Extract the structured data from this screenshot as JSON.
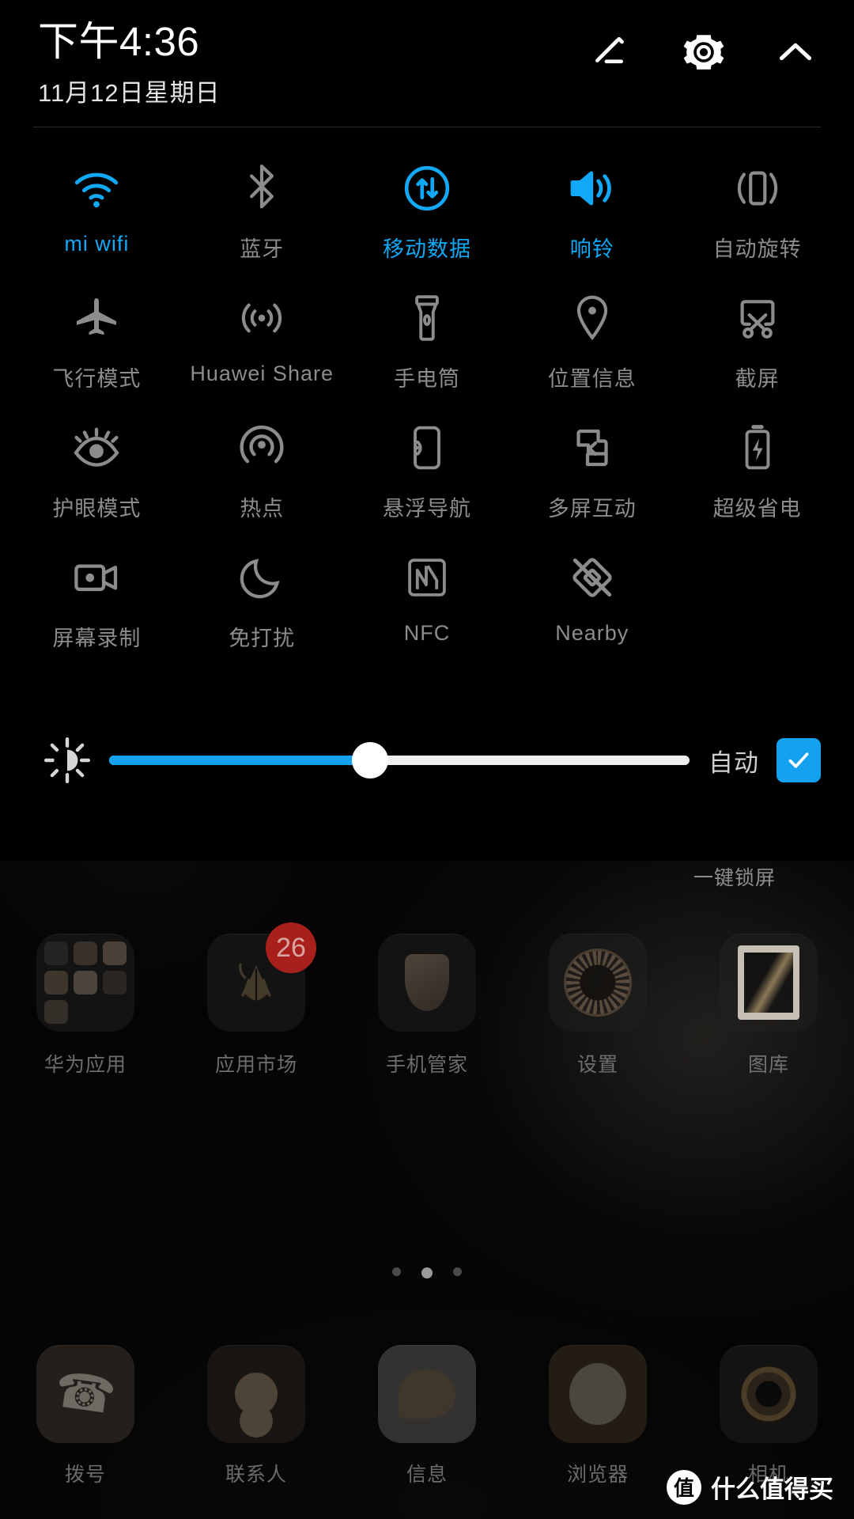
{
  "status": {
    "time": "下午4:36",
    "date": "11月12日星期日"
  },
  "header_actions": [
    {
      "name": "edit-icon",
      "label": "编辑"
    },
    {
      "name": "gear-icon",
      "label": "设置"
    },
    {
      "name": "chevron-up-icon",
      "label": "收起"
    }
  ],
  "colors": {
    "accent": "#11a8f5",
    "inactive": "#8c8c8c",
    "badge": "#a8201c"
  },
  "tiles": [
    [
      {
        "label": "mi wifi",
        "icon": "wifi-icon",
        "active": true
      },
      {
        "label": "蓝牙",
        "icon": "bluetooth-icon",
        "active": false
      },
      {
        "label": "移动数据",
        "icon": "mobile-data-icon",
        "active": true
      },
      {
        "label": "响铃",
        "icon": "ringer-icon",
        "active": true
      },
      {
        "label": "自动旋转",
        "icon": "auto-rotate-icon",
        "active": false
      }
    ],
    [
      {
        "label": "飞行模式",
        "icon": "airplane-icon",
        "active": false
      },
      {
        "label": "Huawei Share",
        "icon": "huawei-share-icon",
        "active": false
      },
      {
        "label": "手电筒",
        "icon": "flashlight-icon",
        "active": false
      },
      {
        "label": "位置信息",
        "icon": "location-pin-icon",
        "active": false
      },
      {
        "label": "截屏",
        "icon": "screenshot-icon",
        "active": false
      }
    ],
    [
      {
        "label": "护眼模式",
        "icon": "eye-comfort-icon",
        "active": false
      },
      {
        "label": "热点",
        "icon": "hotspot-icon",
        "active": false
      },
      {
        "label": "悬浮导航",
        "icon": "floating-nav-icon",
        "active": false
      },
      {
        "label": "多屏互动",
        "icon": "multi-screen-icon",
        "active": false
      },
      {
        "label": "超级省电",
        "icon": "ultra-power-save-icon",
        "active": false
      }
    ],
    [
      {
        "label": "屏幕录制",
        "icon": "screen-record-icon",
        "active": false
      },
      {
        "label": "免打扰",
        "icon": "do-not-disturb-icon",
        "active": false
      },
      {
        "label": "NFC",
        "icon": "nfc-icon",
        "active": false
      },
      {
        "label": "Nearby",
        "icon": "nearby-off-icon",
        "active": false
      },
      {
        "label": "",
        "icon": "",
        "active": false
      }
    ]
  ],
  "brightness": {
    "icon": "brightness-icon",
    "value_percent": 45,
    "auto_label": "自动",
    "auto_checked": true
  },
  "homescreen": {
    "lock_widget_label": "一键锁屏",
    "apps": [
      {
        "label": "华为应用",
        "icon": "folder-icon",
        "badge": ""
      },
      {
        "label": "应用市场",
        "icon": "appgallery-icon",
        "badge": "26"
      },
      {
        "label": "手机管家",
        "icon": "phone-manager-icon",
        "badge": ""
      },
      {
        "label": "设置",
        "icon": "settings-icon",
        "badge": ""
      },
      {
        "label": "图库",
        "icon": "gallery-icon",
        "badge": ""
      }
    ],
    "page_dots": {
      "count": 3,
      "active_index": 1
    },
    "dock": [
      {
        "label": "拨号",
        "icon": "phone-icon"
      },
      {
        "label": "联系人",
        "icon": "contacts-icon"
      },
      {
        "label": "信息",
        "icon": "messages-icon"
      },
      {
        "label": "浏览器",
        "icon": "browser-icon"
      },
      {
        "label": "相机",
        "icon": "camera-icon"
      }
    ]
  },
  "watermark": {
    "mark": "值",
    "text": "什么值得买"
  }
}
